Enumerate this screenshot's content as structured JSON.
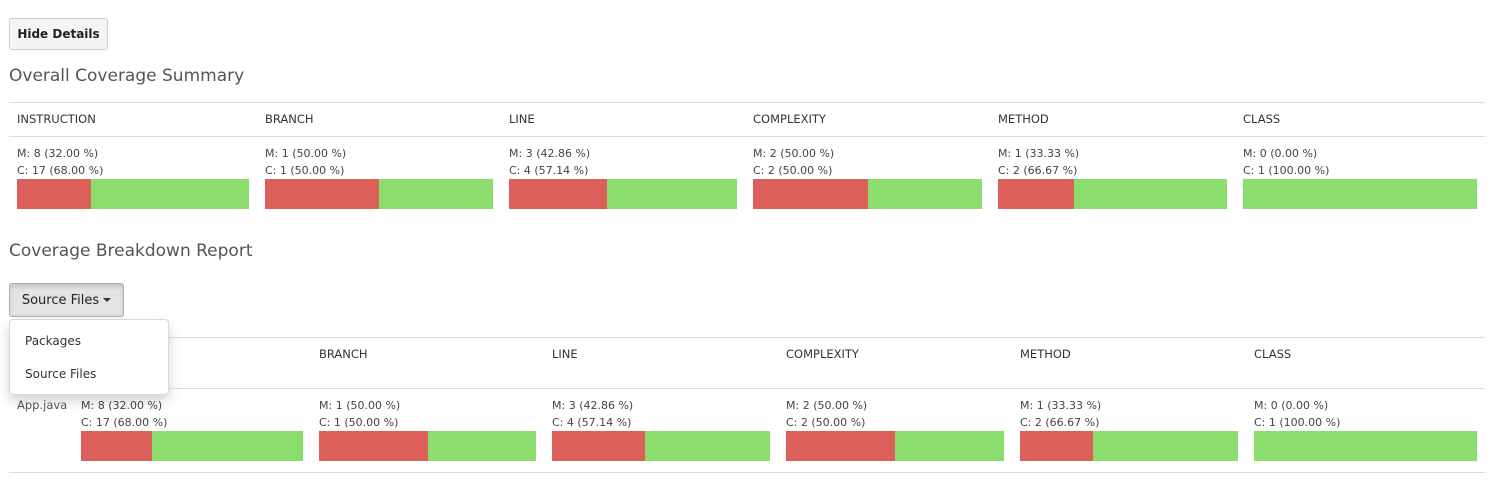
{
  "toolbar": {
    "hide_details_label": "Hide Details"
  },
  "summary": {
    "title": "Overall Coverage Summary",
    "columns": [
      {
        "label": "INSTRUCTION",
        "missed": "M: 8 (32.00 %)",
        "covered": "C: 17 (68.00 %)",
        "missed_fraction": 0.32
      },
      {
        "label": "BRANCH",
        "missed": "M: 1 (50.00 %)",
        "covered": "C: 1 (50.00 %)",
        "missed_fraction": 0.5
      },
      {
        "label": "LINE",
        "missed": "M: 3 (42.86 %)",
        "covered": "C: 4 (57.14 %)",
        "missed_fraction": 0.4286
      },
      {
        "label": "COMPLEXITY",
        "missed": "M: 2 (50.00 %)",
        "covered": "C: 2 (50.00 %)",
        "missed_fraction": 0.5
      },
      {
        "label": "METHOD",
        "missed": "M: 1 (33.33 %)",
        "covered": "C: 2 (66.67 %)",
        "missed_fraction": 0.3333
      },
      {
        "label": "CLASS",
        "missed": "M: 0 (0.00 %)",
        "covered": "C: 1 (100.00 %)",
        "missed_fraction": 0.0
      }
    ]
  },
  "breakdown": {
    "title": "Coverage Breakdown Report",
    "dropdown_label": "Source Files",
    "menu_items": [
      "Packages",
      "Source Files"
    ],
    "column_labels": [
      "BRANCH",
      "LINE",
      "COMPLEXITY",
      "METHOD",
      "CLASS"
    ],
    "rows": [
      {
        "name": "App.java",
        "cells": [
          {
            "missed": "M: 8 (32.00 %)",
            "covered": "C: 17 (68.00 %)",
            "missed_fraction": 0.32
          },
          {
            "missed": "M: 1 (50.00 %)",
            "covered": "C: 1 (50.00 %)",
            "missed_fraction": 0.5
          },
          {
            "missed": "M: 3 (42.86 %)",
            "covered": "C: 4 (57.14 %)",
            "missed_fraction": 0.4286
          },
          {
            "missed": "M: 2 (50.00 %)",
            "covered": "C: 2 (50.00 %)",
            "missed_fraction": 0.5
          },
          {
            "missed": "M: 1 (33.33 %)",
            "covered": "C: 2 (66.67 %)",
            "missed_fraction": 0.3333
          },
          {
            "missed": "M: 0 (0.00 %)",
            "covered": "C: 1 (100.00 %)",
            "missed_fraction": 0.0
          }
        ]
      }
    ]
  },
  "colors": {
    "missed": "#dd5f5a",
    "covered": "#8bdd6d"
  }
}
